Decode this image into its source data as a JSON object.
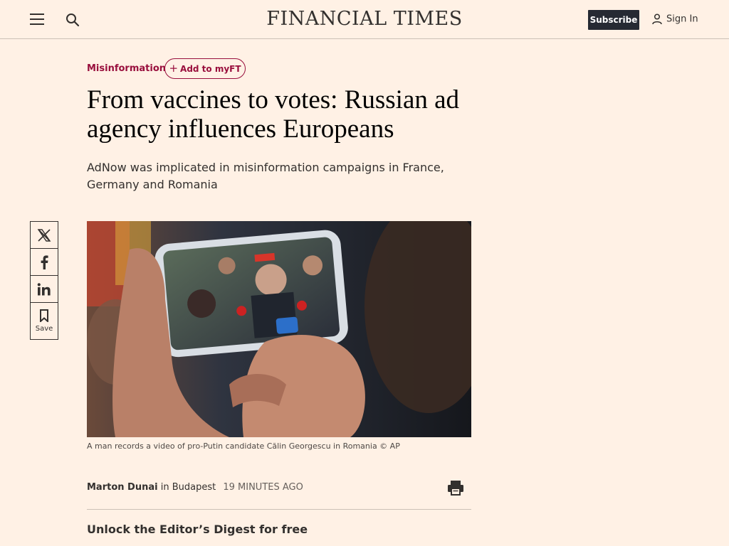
{
  "header": {
    "logo": "FINANCIAL TIMES",
    "subscribe_label": "Subscribe",
    "signin_label": "Sign In"
  },
  "article": {
    "topic": "Misinformation",
    "add_myft_label": "Add to myFT",
    "headline": "From vaccines to votes: Russian ad agency influences Europeans",
    "standfirst": "AdNow was implicated in misinformation campaigns in France, Germany and Romania",
    "image_caption": "A man records a video of pro-Putin candidate Călin Georgescu in Romania © AP",
    "author": "Marton Dunai",
    "location_prefix": "in",
    "location": "Budapest",
    "timestamp": "19 MINUTES AGO",
    "digest_heading": "Unlock the Editor’s Digest for free"
  },
  "share": {
    "save_label": "Save",
    "icons": [
      "x-icon",
      "facebook-icon",
      "linkedin-icon",
      "bookmark-icon"
    ]
  },
  "colors": {
    "background": "#FFF1E5",
    "claret": "#990F3D",
    "subscribe_bg": "#262A33"
  }
}
